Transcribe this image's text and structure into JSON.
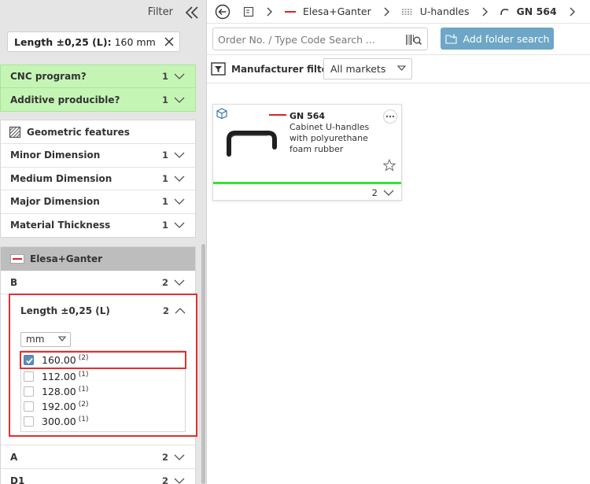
{
  "filter_panel": {
    "title": "Filter",
    "active_chip": {
      "name": "Length ±0,25 (L):",
      "value": "160 mm"
    },
    "green_filters": [
      {
        "label": "CNC program?",
        "count": "1"
      },
      {
        "label": "Additive producible?",
        "count": "1"
      }
    ],
    "geometric": {
      "title": "Geometric features",
      "rows": [
        {
          "label": "Minor Dimension",
          "count": "1"
        },
        {
          "label": "Medium Dimension",
          "count": "1"
        },
        {
          "label": "Major Dimension",
          "count": "1"
        },
        {
          "label": "Material Thickness",
          "count": "1"
        }
      ]
    },
    "manufacturer_section": {
      "title": "Elesa+Ganter",
      "rows": [
        {
          "label": "B",
          "count": "2"
        },
        {
          "label": "A",
          "count": "2"
        },
        {
          "label": "D1",
          "count": "2"
        }
      ],
      "length_filter": {
        "label": "Length ±0,25 (L)",
        "count": "2",
        "unit": "mm",
        "options": [
          {
            "value": "160.00",
            "count": "(2)",
            "checked": true
          },
          {
            "value": "112.00",
            "count": "(1)",
            "checked": false
          },
          {
            "value": "128.00",
            "count": "(1)",
            "checked": false
          },
          {
            "value": "192.00",
            "count": "(2)",
            "checked": false
          },
          {
            "value": "300.00",
            "count": "(1)",
            "checked": false
          }
        ]
      }
    }
  },
  "breadcrumb": {
    "items": [
      {
        "label": "Elesa+Ganter",
        "icon": "manufacturer-logo-icon"
      },
      {
        "label": "U-handles",
        "icon": "category-icon"
      },
      {
        "label": "GN 564",
        "icon": "handle-icon"
      }
    ]
  },
  "search": {
    "placeholder": "Order No. / Type Code Search ...",
    "add_folder_label": "Add folder search"
  },
  "manufacturer_filter": {
    "label": "Manufacturer filter",
    "market_value": "All markets"
  },
  "result_card": {
    "title": "GN 564",
    "description": "Cabinet U-handles with polyurethane foam rubber",
    "count": "2"
  },
  "colors": {
    "accent_button": "#6da6c7",
    "checkbox_checked": "#5b8fb7",
    "green_filter_bg": "#c5f5b5",
    "highlight_red": "#e03030",
    "card_status_bar": "#33e333"
  }
}
